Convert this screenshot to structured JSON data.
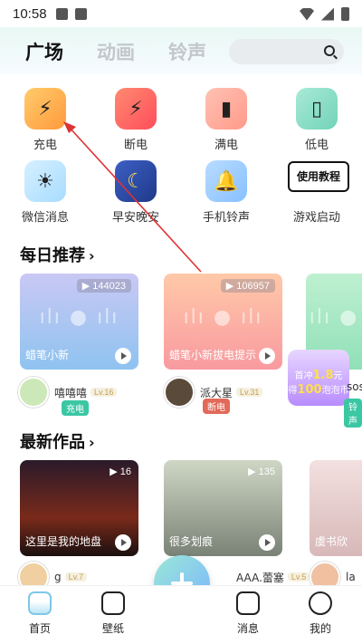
{
  "status": {
    "time": "10:58"
  },
  "tabs": [
    "广场",
    "动画",
    "铃声"
  ],
  "categories": [
    {
      "label": "充电",
      "icon": "bolt-icon",
      "color": "#ffb24a"
    },
    {
      "label": "断电",
      "icon": "bolt-off-icon",
      "color": "#ff5b5b"
    },
    {
      "label": "满电",
      "icon": "battery-full-icon",
      "color": "#ffb0a0"
    },
    {
      "label": "低电",
      "icon": "battery-low-icon",
      "color": "#8fe0c8"
    },
    {
      "label": "微信消息",
      "icon": "sun-icon",
      "color": "#b8e6ff"
    },
    {
      "label": "早安晚安",
      "icon": "moon-icon",
      "color": "#2b4aa8"
    },
    {
      "label": "手机铃声",
      "icon": "bell-icon",
      "color": "#9fd0ff"
    },
    {
      "label": "游戏启动",
      "icon": "game-icon",
      "color": "#ffffff"
    }
  ],
  "tutorial_label": "使用教程",
  "daily": {
    "title": "每日推荐",
    "cards": [
      {
        "plays": "144023",
        "title": "蜡笔小新",
        "user": "嘻嘻嘻",
        "level": "Lv.16",
        "tag": "充电"
      },
      {
        "plays": "106957",
        "title": "蜡笔小新拔电提示",
        "user": "派大星",
        "level": "Lv.31",
        "tag": "断电"
      },
      {
        "plays": "",
        "title": "",
        "user": "soso",
        "level": "",
        "tag": "铃声"
      }
    ]
  },
  "promo": {
    "line1": "首冲",
    "highlight1": "1.8",
    "unit": "元",
    "line2": "得",
    "highlight2": "100",
    "line3": "泡泡币"
  },
  "works": {
    "title": "最新作品",
    "items": [
      {
        "plays": "16",
        "title": "这里是我的地盘",
        "user": "g",
        "level": "Lv.7"
      },
      {
        "plays": "135",
        "title": "很多划痕",
        "user": "AAA.蕾塞",
        "level": "Lv.5"
      },
      {
        "plays": "",
        "title": "虞书欣",
        "user": "la",
        "level": ""
      }
    ]
  },
  "nav": [
    "首页",
    "壁纸",
    "消息",
    "我的"
  ]
}
